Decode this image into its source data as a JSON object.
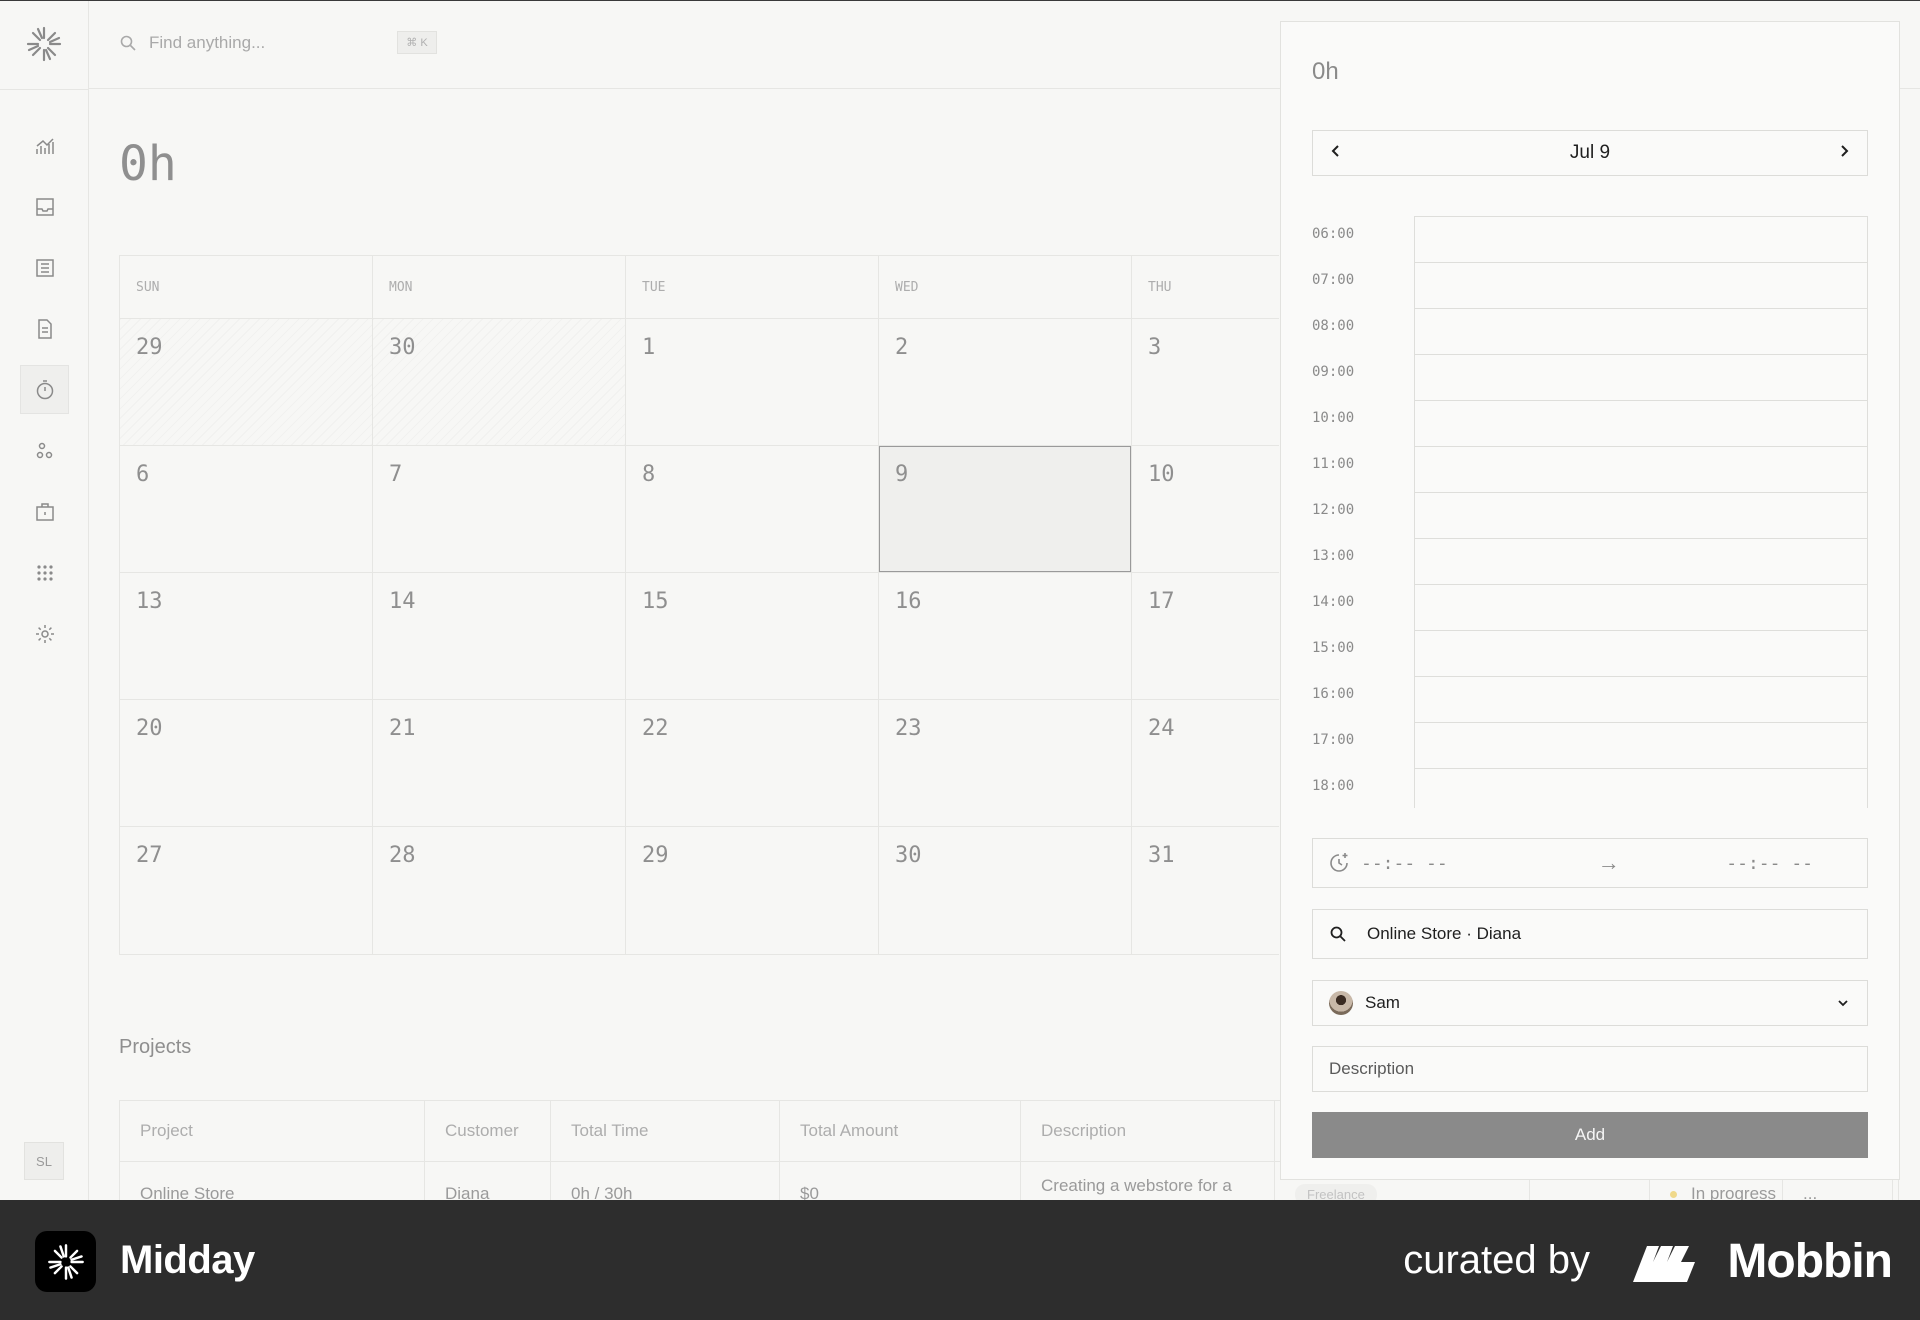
{
  "app": {
    "name": "Midday"
  },
  "search": {
    "placeholder": "Find anything...",
    "shortcut": "⌘ K"
  },
  "sidebar": {
    "items": [
      {
        "id": "overview",
        "icon": "chart-icon"
      },
      {
        "id": "inbox",
        "icon": "inbox-icon"
      },
      {
        "id": "transactions",
        "icon": "list-icon"
      },
      {
        "id": "invoices",
        "icon": "document-icon"
      },
      {
        "id": "tracker",
        "icon": "timer-icon",
        "active": true
      },
      {
        "id": "customers",
        "icon": "people-icon"
      },
      {
        "id": "vault",
        "icon": "briefcase-icon"
      },
      {
        "id": "apps",
        "icon": "grid-icon"
      },
      {
        "id": "settings",
        "icon": "gear-icon"
      }
    ],
    "user_initials": "SL"
  },
  "tracker": {
    "total": "0h",
    "weekdays": [
      "SUN",
      "MON",
      "TUE",
      "WED",
      "THU"
    ],
    "weeks": [
      [
        "29",
        "30",
        "1",
        "2",
        "3"
      ],
      [
        "6",
        "7",
        "8",
        "9",
        "10"
      ],
      [
        "13",
        "14",
        "15",
        "16",
        "17"
      ],
      [
        "20",
        "21",
        "22",
        "23",
        "24"
      ],
      [
        "27",
        "28",
        "29",
        "30",
        "31"
      ]
    ]
  },
  "projects": {
    "title": "Projects",
    "columns": [
      "Project",
      "Customer",
      "Total Time",
      "Total Amount",
      "Description"
    ],
    "row": {
      "project": "Online Store",
      "customer": "Diana",
      "total_time": "0h / 30h",
      "total_amount": "$0",
      "description": "Creating a webstore for a",
      "tag": "Freelance",
      "status": "In progress",
      "menu": "..."
    }
  },
  "panel": {
    "total": "0h",
    "date_label": "Jul 9",
    "hours": [
      "06:00",
      "07:00",
      "08:00",
      "09:00",
      "10:00",
      "11:00",
      "12:00",
      "13:00",
      "14:00",
      "15:00",
      "16:00",
      "17:00",
      "18:00"
    ],
    "start_time": "--:-- --",
    "end_time": "--:-- --",
    "arrow": "→",
    "project_value": "Online Store · Diana",
    "assignee": "Sam",
    "description_placeholder": "Description",
    "add_label": "Add"
  },
  "footer": {
    "brand": "Midday",
    "curated": "curated by",
    "mobbin": "Mobbin"
  }
}
